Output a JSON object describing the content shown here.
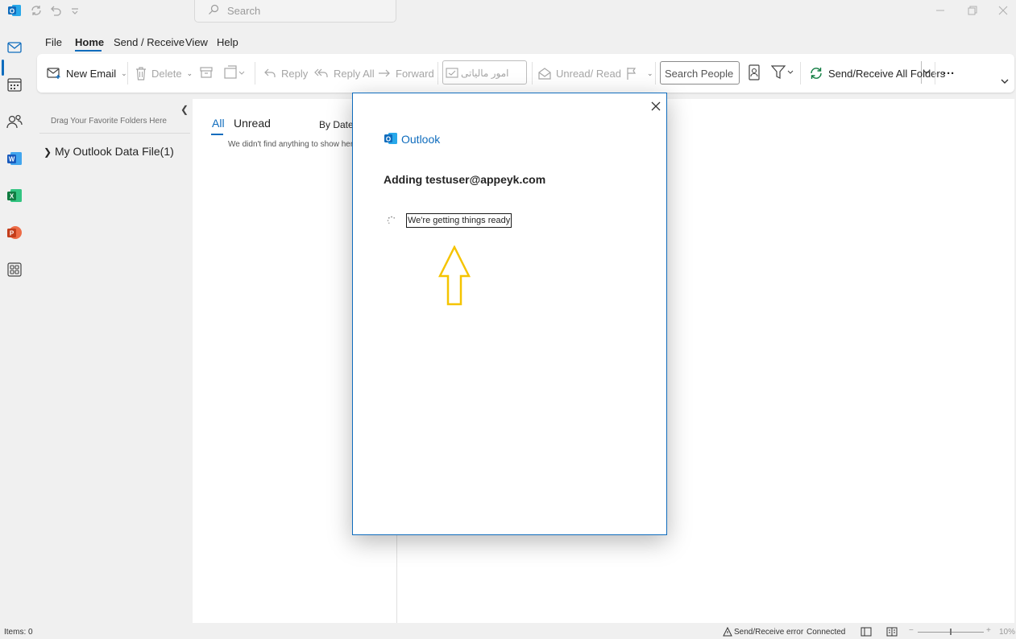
{
  "titlebar": {
    "search_placeholder": "Search"
  },
  "menu": {
    "tabs": [
      "File",
      "Home",
      "Send / Receive",
      "View",
      "Help"
    ],
    "active": "Home"
  },
  "ribbon": {
    "new_email": "New Email",
    "delete": "Delete",
    "reply": "Reply",
    "reply_all": "Reply All",
    "forward": "Forward",
    "move_to_folder": "امور مالیاتی",
    "unread_read": "Unread/ Read",
    "search_people": "Search People",
    "send_receive_all": "Send/Receive All Folders",
    "more": "···"
  },
  "folder_pane": {
    "favorites_hint": "Drag Your Favorite Folders Here",
    "data_file": "My Outlook Data File(1)"
  },
  "message_list": {
    "tab_all": "All",
    "tab_unread": "Unread",
    "sort": "By Date",
    "empty_text": "We didn't find anything to show here."
  },
  "dialog": {
    "brand": "Outlook",
    "title": "Adding testuser@appeyk.com",
    "status": "We're getting things ready"
  },
  "statusbar": {
    "items": "Items: 0",
    "send_receive_error": "Send/Receive error",
    "connection": "Connected",
    "zoom": "10%"
  },
  "colors": {
    "accent": "#0f6cbd",
    "annotation_arrow": "#f5c400"
  }
}
